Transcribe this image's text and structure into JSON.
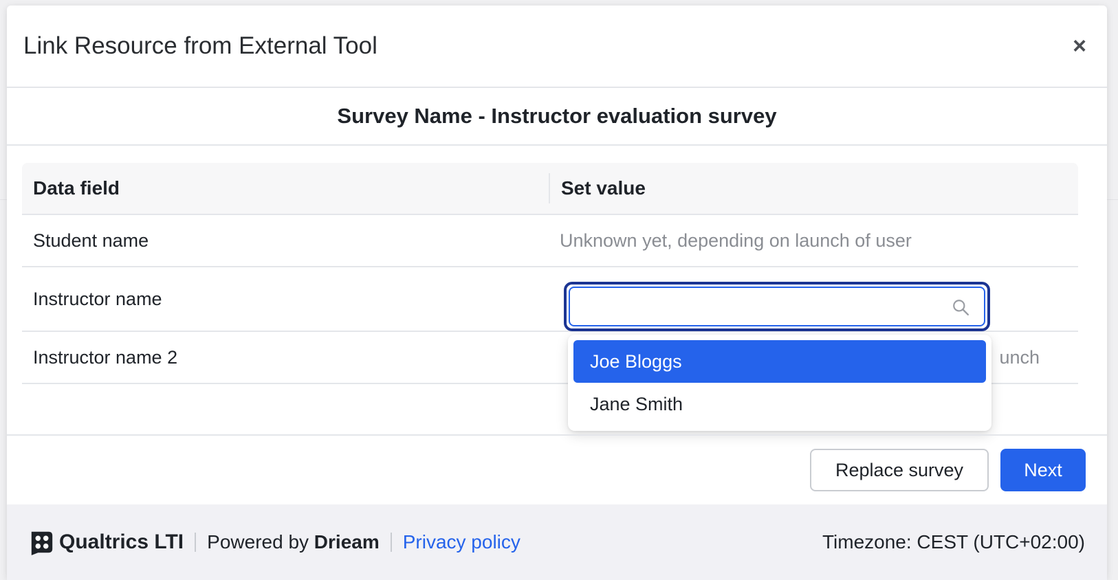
{
  "modal": {
    "title": "Link Resource from External Tool",
    "close_label": "×"
  },
  "survey": {
    "title": "Survey Name - Instructor evaluation survey"
  },
  "table": {
    "headers": [
      "Data field",
      "Set value"
    ],
    "rows": [
      {
        "field": "Student name",
        "value": "Unknown yet, depending on launch of user"
      },
      {
        "field": "Instructor name",
        "value": ""
      },
      {
        "field": "Instructor name 2",
        "value": "unch"
      }
    ]
  },
  "search": {
    "value": "",
    "placeholder": "",
    "icon": "search-icon"
  },
  "dropdown": {
    "options": [
      "Joe Bloggs",
      "Jane Smith"
    ],
    "selected": "Joe Bloggs"
  },
  "actions": {
    "replace_label": "Replace survey",
    "next_label": "Next"
  },
  "footer": {
    "brand": "Qualtrics LTI",
    "powered_prefix": "Powered by",
    "powered_company": "Drieam",
    "privacy": "Privacy policy",
    "timezone": "Timezone: CEST (UTC+02:00)"
  },
  "colors": {
    "primary": "#2563eb",
    "focus_ring": "#1c3593"
  }
}
